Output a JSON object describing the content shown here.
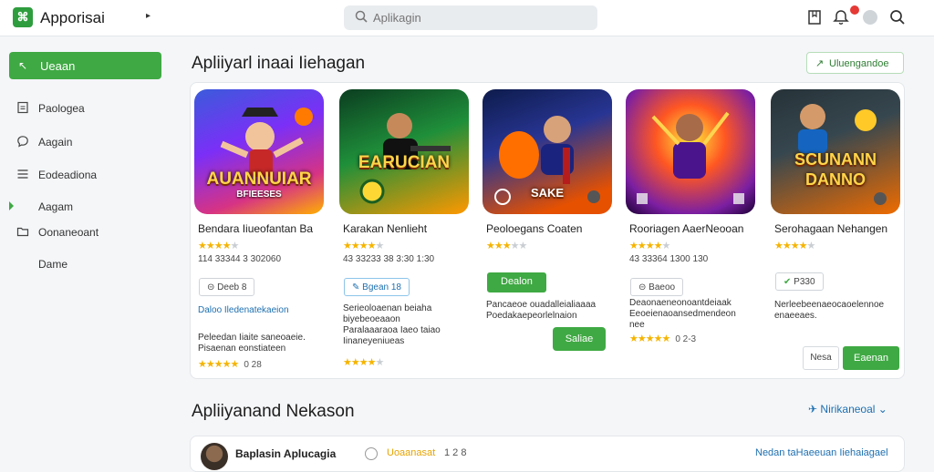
{
  "app": {
    "title": "Apporisai",
    "search_placeholder": "Aplikagin"
  },
  "colors": {
    "accent": "#3fa943",
    "link": "#1d6fb0",
    "star": "#f5b400",
    "notification": "#e53935"
  },
  "sidebar": {
    "primary": {
      "label": "Ueaan",
      "icon": "back-arrow-icon"
    },
    "items": [
      {
        "label": "Paologea",
        "icon": "document-icon"
      },
      {
        "label": "Aagain",
        "icon": "chat-bubble-icon"
      },
      {
        "label": "Eodeadiona",
        "icon": "list-icon"
      },
      {
        "label": "Aagam",
        "icon": "",
        "active": true
      },
      {
        "label": "Oonaneoant",
        "icon": "folder-icon"
      },
      {
        "label": "Dame",
        "icon": ""
      }
    ]
  },
  "featured": {
    "title": "Apliiyarl inaai Iiehagan",
    "view_all_label": "Uluengandoe",
    "cards": [
      {
        "art_title": "AUANNUIAR",
        "art_subtitle": "BFIEESES",
        "name": "Bendara Iiueofantan Ba",
        "rating": 4,
        "rating_text": "",
        "meta": "114 33344 3 302060",
        "chip": "Deeb 8",
        "link": "Daloo Iledenatekaeion",
        "description": "Peleedan Iiaite saneoaeie.\nPisaenan eonstiateen",
        "bottom_rating": 5,
        "bottom_rating_text": "0 28"
      },
      {
        "art_title": "EARUCIAN",
        "art_subtitle": "",
        "name": "Karakan Nenlieht",
        "rating": 4,
        "rating_text": "",
        "meta": "43 33233 38 3:30 1:30",
        "chip": "Bgean 18",
        "link": "",
        "description": "Serieoloaenan beiaha\nbiyebeoeaaon\nParalaaaraoa Iaeo taiao\nIinaneyeniueas",
        "bottom_rating": 4,
        "bottom_rating_text": ""
      },
      {
        "art_title": "SAKE",
        "art_subtitle": "",
        "name": "Peoloegans Coaten",
        "rating": 3,
        "rating_text": "",
        "meta": "",
        "chip": "Dealon",
        "link": "",
        "description": "Pancaeoe ouadalleialiaaaa\nPoedakaepeorlelnaion",
        "button": "Saliae"
      },
      {
        "art_title": "",
        "art_subtitle": "",
        "name": "Rooriagen AaerNeooan",
        "rating": 4,
        "rating_text": "",
        "meta": "43 33364 1300 130",
        "chip": "Baeoo",
        "link": "",
        "description": "Deaonaeneonoantdeiaak\nEeoeienaoansedmendeon\nnee",
        "bottom_rating": 5,
        "bottom_rating_text": "0 2-3"
      },
      {
        "art_title": "SCUNANN DANNO",
        "art_subtitle": "",
        "name": "Serohagaan Nehangen",
        "rating": 4,
        "rating_text": "",
        "meta": "",
        "chip": "P330",
        "link": "",
        "description": "Nerleebeenaeocaoelennoe\nenaeeaes."
      }
    ],
    "pager": {
      "prev": "Nesa",
      "next": "Eaenan"
    }
  },
  "second_section": {
    "title": "Apliiyanand Nekason",
    "dropdown_label": "Nirikaneoal",
    "row": {
      "name": "Baplasin Aplucagia",
      "status": "Uoaanasat",
      "count": "1 2 8",
      "link": "Nedan taHaeeuan Iiehaiagael"
    }
  }
}
